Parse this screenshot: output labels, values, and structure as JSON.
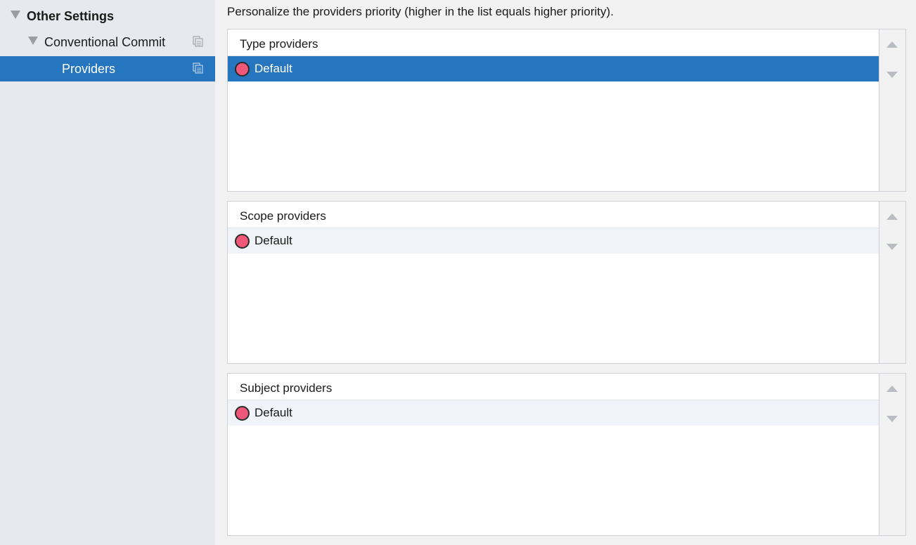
{
  "sidebar": {
    "items": [
      {
        "label": "Other Settings",
        "level": 0,
        "expanded": true,
        "bold": true
      },
      {
        "label": "Conventional Commit",
        "level": 1,
        "expanded": true
      },
      {
        "label": "Providers",
        "level": 2,
        "selected": true
      }
    ]
  },
  "content": {
    "description": "Personalize the providers priority (higher in the list equals higher priority).",
    "groups": [
      {
        "title": "Type providers",
        "items": [
          {
            "label": "Default",
            "selected": true
          }
        ]
      },
      {
        "title": "Scope providers",
        "items": [
          {
            "label": "Default",
            "selected": false
          }
        ]
      },
      {
        "title": "Subject providers",
        "items": [
          {
            "label": "Default",
            "selected": false
          }
        ]
      }
    ]
  },
  "icons": {
    "tree_expanded": "triangle-down-icon",
    "copy": "copy-icon",
    "provider_dot": "circle-icon",
    "move_up": "arrow-up-icon",
    "move_down": "arrow-down-icon"
  },
  "colors": {
    "selection": "#2675bf",
    "sidebar_bg": "#e6eaef",
    "dot_fill": "#f0587a",
    "arrow": "#b9bcc0"
  }
}
